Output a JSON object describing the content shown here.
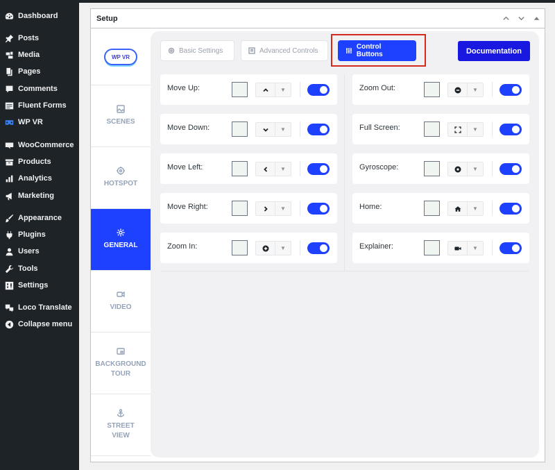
{
  "sidebar": {
    "items": [
      {
        "label": "Dashboard",
        "icon": "dashboard-icon"
      },
      {
        "label": "Posts",
        "icon": "pin-icon"
      },
      {
        "label": "Media",
        "icon": "media-icon"
      },
      {
        "label": "Pages",
        "icon": "pages-icon"
      },
      {
        "label": "Comments",
        "icon": "comment-icon"
      },
      {
        "label": "Fluent Forms",
        "icon": "form-icon"
      },
      {
        "label": "WP VR",
        "icon": "vr-icon"
      },
      {
        "label": "WooCommerce",
        "icon": "woo-icon"
      },
      {
        "label": "Products",
        "icon": "archive-icon"
      },
      {
        "label": "Analytics",
        "icon": "chart-icon"
      },
      {
        "label": "Marketing",
        "icon": "megaphone-icon"
      },
      {
        "label": "Appearance",
        "icon": "brush-icon"
      },
      {
        "label": "Plugins",
        "icon": "plugin-icon"
      },
      {
        "label": "Users",
        "icon": "user-icon"
      },
      {
        "label": "Tools",
        "icon": "wrench-icon"
      },
      {
        "label": "Settings",
        "icon": "settings-icon"
      },
      {
        "label": "Loco Translate",
        "icon": "translate-icon"
      },
      {
        "label": "Collapse menu",
        "icon": "collapse-icon"
      }
    ]
  },
  "metabox": {
    "title": "Setup",
    "logo_text": "WP VR"
  },
  "tabs": [
    {
      "label": "SCENES",
      "label2": ""
    },
    {
      "label": "HOTSPOT",
      "label2": ""
    },
    {
      "label": "GENERAL",
      "label2": ""
    },
    {
      "label": "VIDEO",
      "label2": ""
    },
    {
      "label": "BACKGROUND",
      "label2": "TOUR"
    },
    {
      "label": "STREET",
      "label2": "VIEW"
    }
  ],
  "toptabs": {
    "basic": "Basic Settings",
    "advanced": "Advanced Controls",
    "control": "Control Buttons",
    "documentation": "Documentation"
  },
  "controls_left": [
    {
      "label": "Move Up:",
      "symbol": "^"
    },
    {
      "label": "Move Down:",
      "symbol": "⌄"
    },
    {
      "label": "Move Left:",
      "symbol": "<"
    },
    {
      "label": "Move Right:",
      "symbol": ">"
    },
    {
      "label": "Zoom In:",
      "symbol": "plus-circle"
    }
  ],
  "controls_right": [
    {
      "label": "Zoom Out:",
      "symbol": "minus-circle"
    },
    {
      "label": "Full Screen:",
      "symbol": "fullscreen"
    },
    {
      "label": "Gyroscope:",
      "symbol": "dot-circle"
    },
    {
      "label": "Home:",
      "symbol": "home"
    },
    {
      "label": "Explainer:",
      "symbol": "video"
    }
  ],
  "colors": {
    "accent": "#1e40ff",
    "highlight": "#d42a1b",
    "sidebar_bg": "#1d2327"
  }
}
